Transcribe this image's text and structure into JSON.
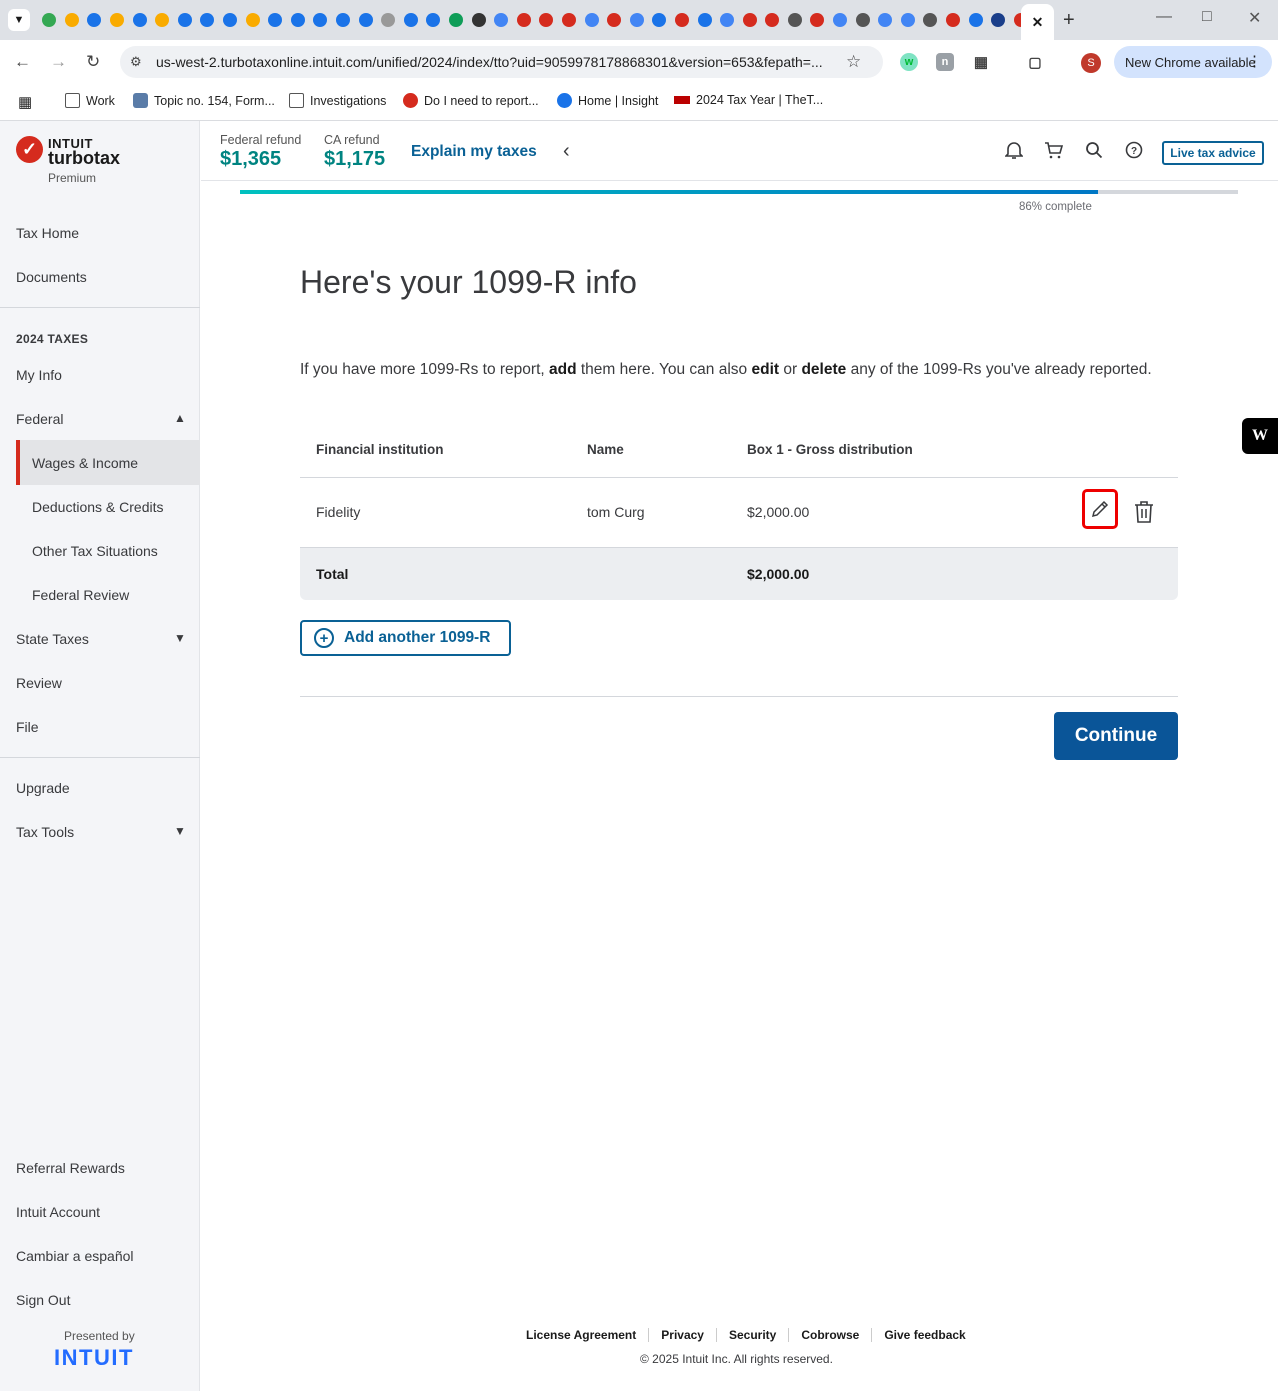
{
  "browser": {
    "url": "us-west-2.turbotaxonline.intuit.com/unified/2024/index/tto?uid=9059978178868301&version=653&fepath=...",
    "chrome_update_label": "New Chrome available",
    "profile_initial": "S",
    "bookmarks": [
      "Work",
      "Topic no. 154, Form...",
      "Investigations",
      "Do I need to report...",
      "Home | Insight",
      "2024 Tax Year | TheT..."
    ]
  },
  "brand": {
    "intuit": "INTUIT",
    "name": "turbotax",
    "tier": "Premium",
    "presented_by": "Presented by",
    "footer_logo": "INTUIT"
  },
  "sidebar": {
    "tax_home": "Tax Home",
    "documents": "Documents",
    "section_heading": "2024 TAXES",
    "my_info": "My Info",
    "federal": "Federal",
    "federal_sub": [
      "Wages & Income",
      "Deductions & Credits",
      "Other Tax Situations",
      "Federal Review"
    ],
    "state_taxes": "State Taxes",
    "review": "Review",
    "file": "File",
    "upgrade": "Upgrade",
    "tax_tools": "Tax Tools",
    "referral": "Referral Rewards",
    "account": "Intuit Account",
    "spanish": "Cambiar a español",
    "sign_out": "Sign Out"
  },
  "header": {
    "federal_label": "Federal refund",
    "federal_amount": "$1,365",
    "ca_label": "CA refund",
    "ca_amount": "$1,175",
    "explain": "Explain my taxes",
    "live_advice": "Live tax advice"
  },
  "progress": {
    "percent": 86,
    "label": "86% complete"
  },
  "main": {
    "title": "Here's your 1099-R info",
    "intro_1": "If you have more 1099-Rs to report, ",
    "intro_add": "add",
    "intro_2": " them here. You can also ",
    "intro_edit": "edit",
    "intro_3": " or ",
    "intro_delete": "delete",
    "intro_4": " any of the 1099-Rs you've already reported.",
    "table": {
      "headers": [
        "Financial institution",
        "Name",
        "Box 1 - Gross distribution"
      ],
      "rows": [
        [
          "Fidelity",
          "tom Curg",
          "$2,000.00"
        ]
      ],
      "total_label": "Total",
      "total_value": "$2,000.00"
    },
    "add_button": "Add another 1099-R",
    "continue_button": "Continue"
  },
  "footer": {
    "links": [
      "License Agreement",
      "Privacy",
      "Security",
      "Cobrowse",
      "Give feedback"
    ],
    "copyright": "© 2025 Intuit Inc. All rights reserved."
  },
  "colors": {
    "brand_red": "#d52b1e",
    "link_blue": "#0a6195",
    "refund_green": "#008481",
    "primary_button": "#0a5598"
  }
}
